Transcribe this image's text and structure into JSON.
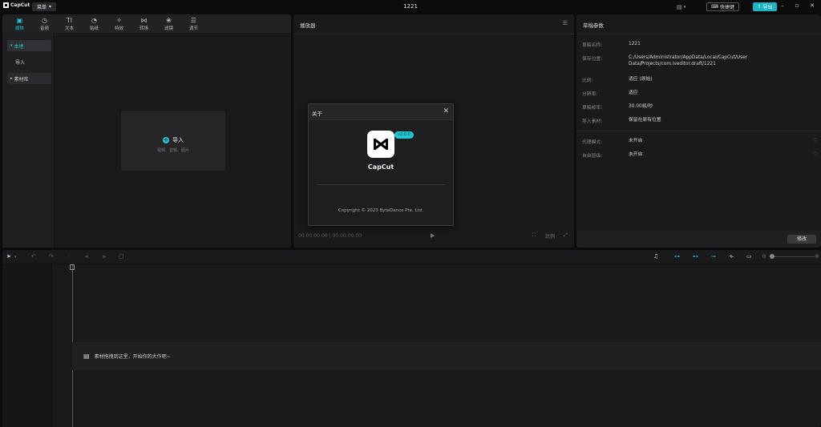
{
  "titlebar": {
    "app_name": "CapCut",
    "menu_label": "菜单",
    "window_title": "1221",
    "shortcut_label": "快捷键",
    "export_label": "导出"
  },
  "media": {
    "tabs": [
      {
        "label": "媒体",
        "icon": "media-icon",
        "active": true
      },
      {
        "label": "音频",
        "icon": "audio-icon"
      },
      {
        "label": "文本",
        "icon": "text-icon"
      },
      {
        "label": "贴纸",
        "icon": "sticker-icon"
      },
      {
        "label": "特效",
        "icon": "effects-icon"
      },
      {
        "label": "转场",
        "icon": "transition-icon"
      },
      {
        "label": "滤镜",
        "icon": "filter-icon"
      },
      {
        "label": "调节",
        "icon": "adjust-icon"
      }
    ],
    "sidebar": {
      "local": "本地",
      "import": "导入",
      "library": "素材库"
    },
    "import_box": {
      "title": "导入",
      "subtitle": "视频、音频、图片"
    }
  },
  "player": {
    "title": "播放器",
    "timecode": "00:00:00:00 | 00:00:00:00",
    "ratio_label": "比例"
  },
  "about": {
    "title": "关于",
    "app_name": "CapCut",
    "version": "v2.0.0",
    "copyright": "Copyright © 2023 ByteDance Pte. Ltd."
  },
  "props": {
    "title": "草稿参数",
    "rows": [
      {
        "key": "草稿名称:",
        "value": "1221"
      },
      {
        "key": "保存位置:",
        "value": "C:/Users/Administrator/AppData/Local/CapCut/User Data/Projects/com.lveditor.draft/1221"
      },
      {
        "key": "比例:",
        "value": "适应 (原始)"
      },
      {
        "key": "分辨率:",
        "value": "适应"
      },
      {
        "key": "草稿帧率:",
        "value": "30.00帧/秒"
      },
      {
        "key": "导入素材:",
        "value": "保留在原有位置"
      }
    ],
    "rows2": [
      {
        "key": "代理模式:",
        "value": "未开启"
      },
      {
        "key": "自由层级:",
        "value": "未开启"
      }
    ],
    "edit_label": "修改"
  },
  "timeline": {
    "hint": "素材拖拽到这里，开始你的大作吧~"
  },
  "colors": {
    "accent": "#1fc6d4",
    "background": "#0c0c0d",
    "panel": "#1a1a1c"
  }
}
